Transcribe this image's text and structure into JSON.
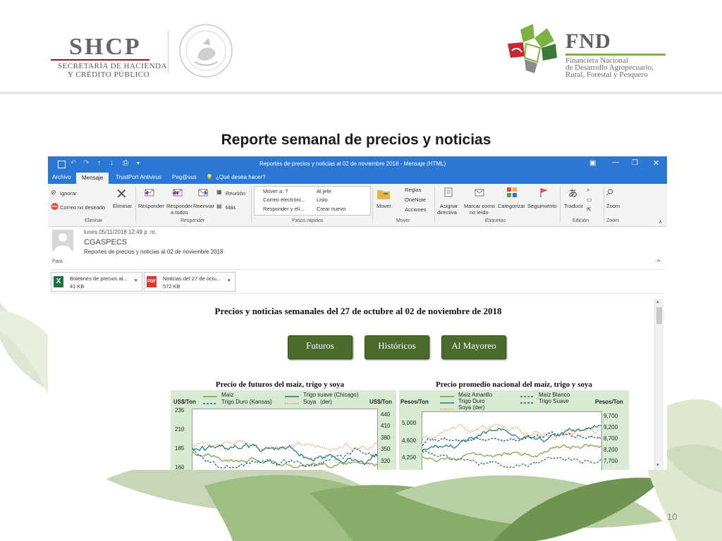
{
  "header": {
    "shcp_logo": "SHCP",
    "shcp_line1": "SECRETARÍA DE HACIENDA",
    "shcp_line2": "Y CRÉDITO PÚBLICO",
    "seal_text": "ESTADOS UNIDOS MEXICANOS",
    "fnd_logo": "FND",
    "fnd_line1": "Financiera Nacional",
    "fnd_line2": "de Desarrollo Agropecuario,",
    "fnd_line3": "Rural, Forestal y Pesquero"
  },
  "slide": {
    "title": "Reporte semanal de precios y noticias",
    "page_number": "10"
  },
  "outlook": {
    "window_title": "Reportes de precios y noticias al 02 de noviembre 2018 - Mensaje (HTML)",
    "tabs": [
      "Archivo",
      "Mensaje",
      "TrustPort Antivirus",
      "Peg@sus",
      "¿Qué desea hacer?"
    ],
    "ribbon": {
      "ignorar": "Ignorar",
      "correo_no_deseado": "Correo no deseado",
      "eliminar": "Eliminar",
      "responder": "Responder",
      "responder_todos_1": "Responder",
      "responder_todos_2": "a todos",
      "reenviar": "Reenviar",
      "reunion": "Reunión",
      "mas": "Más",
      "mover_a": "Mover a: ?",
      "correo_electronico": "Correo electróni...",
      "responder_eli": "Responder y eli...",
      "al_jefe": "Al jefe",
      "listo": "Listo",
      "crear_nuevo": "Crear nuevo",
      "mover": "Mover",
      "reglas": "Reglas",
      "onenote": "OneNote",
      "acciones": "Acciones",
      "asignar_1": "Asignar",
      "asignar_2": "directiva",
      "marcar_1": "Marcar como",
      "marcar_2": "no leído",
      "categorizar": "Categorizar",
      "seguimiento": "Seguimiento",
      "traducir": "Traducir",
      "zoom": "Zoom",
      "groups": {
        "eliminar": "Eliminar",
        "responder": "Responder",
        "pasos_rapidos": "Pasos rápidos",
        "mover": "Mover",
        "etiquetas": "Etiquetas",
        "edicion": "Edición",
        "zoom": "Zoom"
      }
    },
    "message": {
      "date": "lunes 05/11/2018 12:49 p. m.",
      "sender": "CGASPECS",
      "subject": "Reportes de precios y noticias al 02 de noviembre 2018",
      "to_label": "Para"
    },
    "attachments": [
      {
        "name": "Boletines de precios al...",
        "size": "41 KB"
      },
      {
        "name": "Noticias del 27 de octu...",
        "size": "572 KB"
      }
    ]
  },
  "email_body": {
    "heading": "Precios y noticias semanales del 27 de octubre al 02 de noviembre de 2018",
    "buttons": [
      "Futuros",
      "Históricos",
      "Al Mayoreo"
    ]
  },
  "chart_data": [
    {
      "type": "line",
      "title": "Precio de futuros del maíz, trigo y soya",
      "ylabel": "US$/Ton",
      "y2label": "US$/Ton",
      "yticks": [
        "235",
        "210",
        "185",
        "160"
      ],
      "y2ticks": [
        "440",
        "410",
        "380",
        "350",
        "320"
      ],
      "legend": [
        "Maíz",
        "Trigo suave (Chicago)",
        "Trigo Duro (Kansas)",
        "Soya",
        "(der)"
      ],
      "colors": {
        "maiz": "#7aa03a",
        "trigo_suave": "#1a7a6e",
        "trigo_duro": "#1f5aa6",
        "soya": "#f0914a"
      }
    },
    {
      "type": "line",
      "title": "Precio promedio nacional del maíz, trigo y soya",
      "ylabel": "Pesos/Ton",
      "y2label": "Pesos/Ton",
      "yticks": [
        "5,000",
        "4,600",
        "4,200"
      ],
      "y2ticks": [
        "9,700",
        "9,200",
        "8,700",
        "8,200",
        "7,700"
      ],
      "legend": [
        "Maíz Amarillo",
        "Maíz Blanco",
        "Trigo Duro",
        "Trigo Suave",
        "Soya (der)"
      ],
      "colors": {
        "maiz_amarillo": "#7aa03a",
        "maiz_blanco": "#2f6e58",
        "trigo_duro": "#1a7a6e",
        "trigo_suave": "#1f4f8c",
        "soya": "#f0914a"
      }
    }
  ]
}
